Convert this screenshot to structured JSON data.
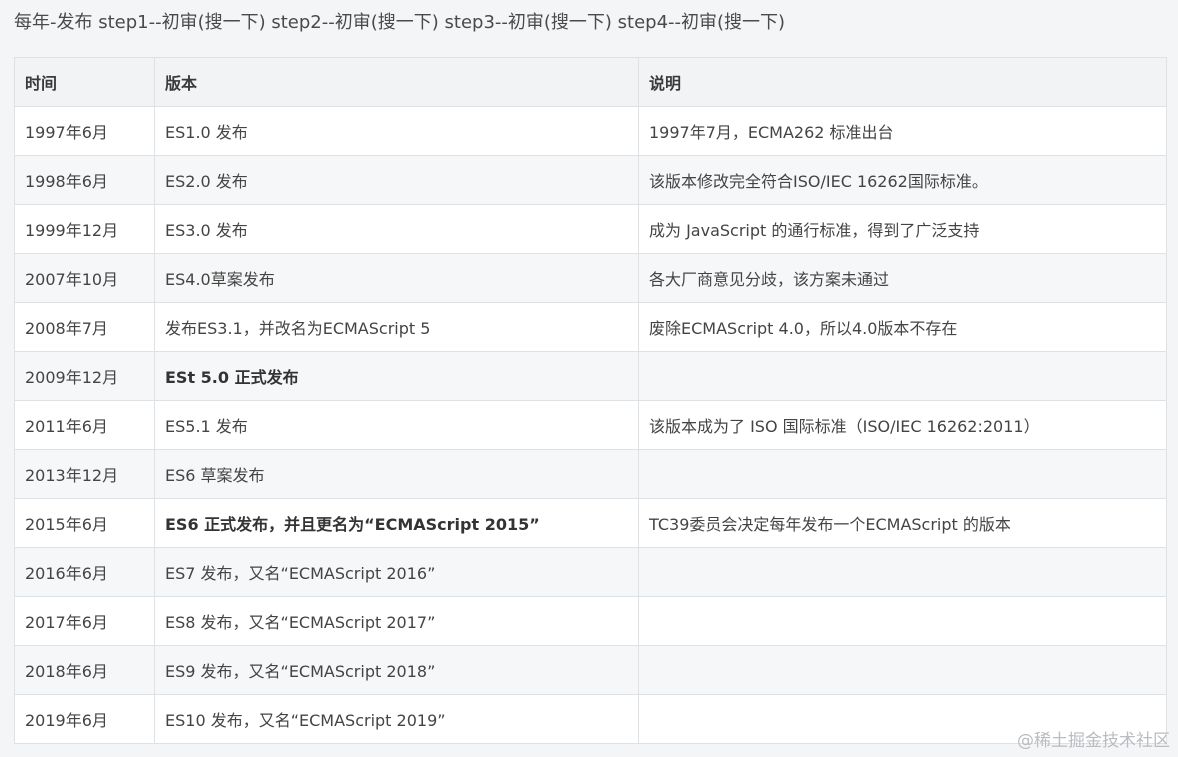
{
  "intro_text": "每年-发布 step1--初审(搜一下) step2--初审(搜一下) step3--初审(搜一下) step4--初审(搜一下)",
  "table": {
    "headers": [
      "时间",
      "版本",
      "说明"
    ],
    "rows": [
      {
        "time": "1997年6月",
        "version": "ES1.0 发布",
        "note": "1997年7月，ECMA262 标准出台",
        "bold": false
      },
      {
        "time": "1998年6月",
        "version": "ES2.0 发布",
        "note": "该版本修改完全符合ISO/IEC 16262国际标准。",
        "bold": false
      },
      {
        "time": "1999年12月",
        "version": "ES3.0 发布",
        "note": "成为 JavaScript 的通行标准，得到了广泛支持",
        "bold": false
      },
      {
        "time": "2007年10月",
        "version": "ES4.0草案发布",
        "note": "各大厂商意见分歧，该方案未通过",
        "bold": false
      },
      {
        "time": "2008年7月",
        "version": "发布ES3.1，并改名为ECMAScript 5",
        "note": "废除ECMAScript 4.0，所以4.0版本不存在",
        "bold": false
      },
      {
        "time": "2009年12月",
        "version": "ESt 5.0 正式发布",
        "note": "",
        "bold": true
      },
      {
        "time": "2011年6月",
        "version": "ES5.1 发布",
        "note": "该版本成为了 ISO 国际标准（ISO/IEC 16262:2011）",
        "bold": false
      },
      {
        "time": "2013年12月",
        "version": "ES6 草案发布",
        "note": "",
        "bold": false
      },
      {
        "time": "2015年6月",
        "version": "ES6 正式发布，并且更名为“ECMAScript 2015”",
        "note": "TC39委员会决定每年发布一个ECMAScript 的版本",
        "bold": true
      },
      {
        "time": "2016年6月",
        "version": "ES7 发布，又名“ECMAScript 2016”",
        "note": "",
        "bold": false
      },
      {
        "time": "2017年6月",
        "version": "ES8 发布，又名“ECMAScript 2017”",
        "note": "",
        "bold": false
      },
      {
        "time": "2018年6月",
        "version": "ES9 发布，又名“ECMAScript 2018”",
        "note": "",
        "bold": false
      },
      {
        "time": "2019年6月",
        "version": "ES10 发布，又名“ECMAScript 2019”",
        "note": "",
        "bold": false
      }
    ]
  },
  "watermark": "@稀土掘金技术社区"
}
